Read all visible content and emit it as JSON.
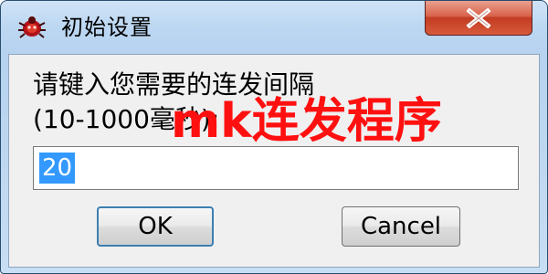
{
  "window": {
    "title": "初始设置",
    "app_icon": "bug-icon",
    "close_icon": "close-icon"
  },
  "dialog": {
    "prompt_line1": "请键入您需要的连发间隔",
    "prompt_line2": "(10-1000毫秒):",
    "input_value": "20",
    "ok_label": "OK",
    "cancel_label": "Cancel"
  },
  "overlay": {
    "watermark": "mk连发程序"
  },
  "colors": {
    "selection": "#3399ff",
    "watermark": "#ff1010",
    "close_button": "#c94a30",
    "title_bar": "#bcd7f2"
  }
}
